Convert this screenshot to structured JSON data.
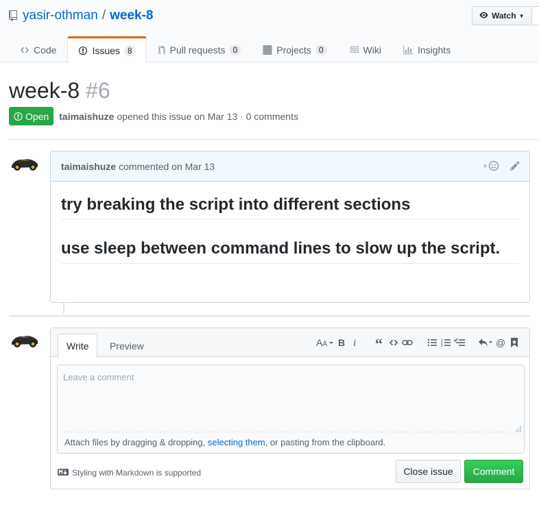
{
  "repo": {
    "owner": "yasir-othman",
    "separator": "/",
    "name": "week-8",
    "watch_label": "Watch"
  },
  "tabs": [
    {
      "label": "Code",
      "icon": "code-icon"
    },
    {
      "label": "Issues",
      "icon": "issue-opened-icon",
      "count": "8"
    },
    {
      "label": "Pull requests",
      "icon": "git-pull-request-icon",
      "count": "0"
    },
    {
      "label": "Projects",
      "icon": "project-icon",
      "count": "0"
    },
    {
      "label": "Wiki",
      "icon": "book-icon"
    },
    {
      "label": "Insights",
      "icon": "graph-icon"
    }
  ],
  "issue": {
    "title": "week-8",
    "number": "#6",
    "state": "Open",
    "author": "taimaishuze",
    "meta_text": "opened this issue on Mar 13 · 0 comments"
  },
  "comment": {
    "author": "taimaishuze",
    "meta_text": "commented on Mar 13",
    "heading_1": "try breaking the script into different sections",
    "heading_2": "use sleep between command lines to slow up the script."
  },
  "new_comment": {
    "write_tab": "Write",
    "preview_tab": "Preview",
    "placeholder": "Leave a comment",
    "attach_prefix": "Attach files by dragging & dropping, ",
    "attach_link": "selecting them",
    "attach_suffix": ", or pasting from the clipboard.",
    "markdown_note": "Styling with Markdown is supported",
    "close_button": "Close issue",
    "comment_button": "Comment"
  },
  "colors": {
    "accent": "#0366d6",
    "open_green": "#28a745",
    "tab_orange": "#e36209"
  }
}
